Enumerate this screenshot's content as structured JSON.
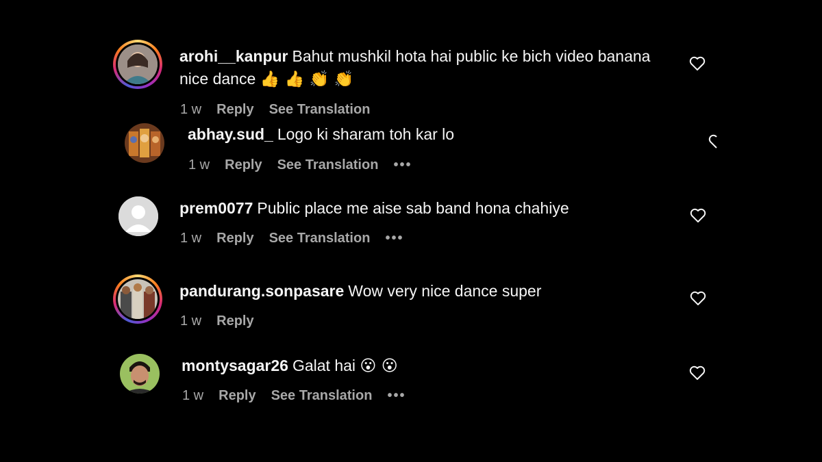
{
  "comments": [
    {
      "username": "arohi__kanpur",
      "text": "Bahut mushkil hota hai public ke bich video banana nice dance",
      "emojis": "👍 👍 👏 👏",
      "time": "1 w",
      "reply_label": "Reply",
      "translation_label": "See Translation",
      "has_story_ring": true,
      "avatar_icon": "woman-photo"
    },
    {
      "username": "abhay.sud_",
      "text": "Logo ki sharam toh kar lo",
      "time": "1 w",
      "reply_label": "Reply",
      "translation_label": "See Translation",
      "more": "•••",
      "has_story_ring": false,
      "avatar_icon": "deity-photo"
    },
    {
      "username": "prem0077",
      "text": "Public place me aise sab band hona chahiye",
      "time": "1 w",
      "reply_label": "Reply",
      "translation_label": "See Translation",
      "more": "•••",
      "has_story_ring": false,
      "avatar_icon": "default-user"
    },
    {
      "username": "pandurang.sonpasare",
      "text": "Wow very nice dance super",
      "time": "1 w",
      "reply_label": "Reply",
      "has_story_ring": true,
      "avatar_icon": "group-photo"
    },
    {
      "username": "montysagar26",
      "text": "Galat hai",
      "emojis": "😮 😮",
      "time": "1 w",
      "reply_label": "Reply",
      "translation_label": "See Translation",
      "more": "•••",
      "has_story_ring": false,
      "avatar_icon": "man-photo"
    }
  ],
  "colors": {
    "background": "#000000",
    "primary_text": "#f5f5f5",
    "secondary_text": "#a8a8a8"
  }
}
